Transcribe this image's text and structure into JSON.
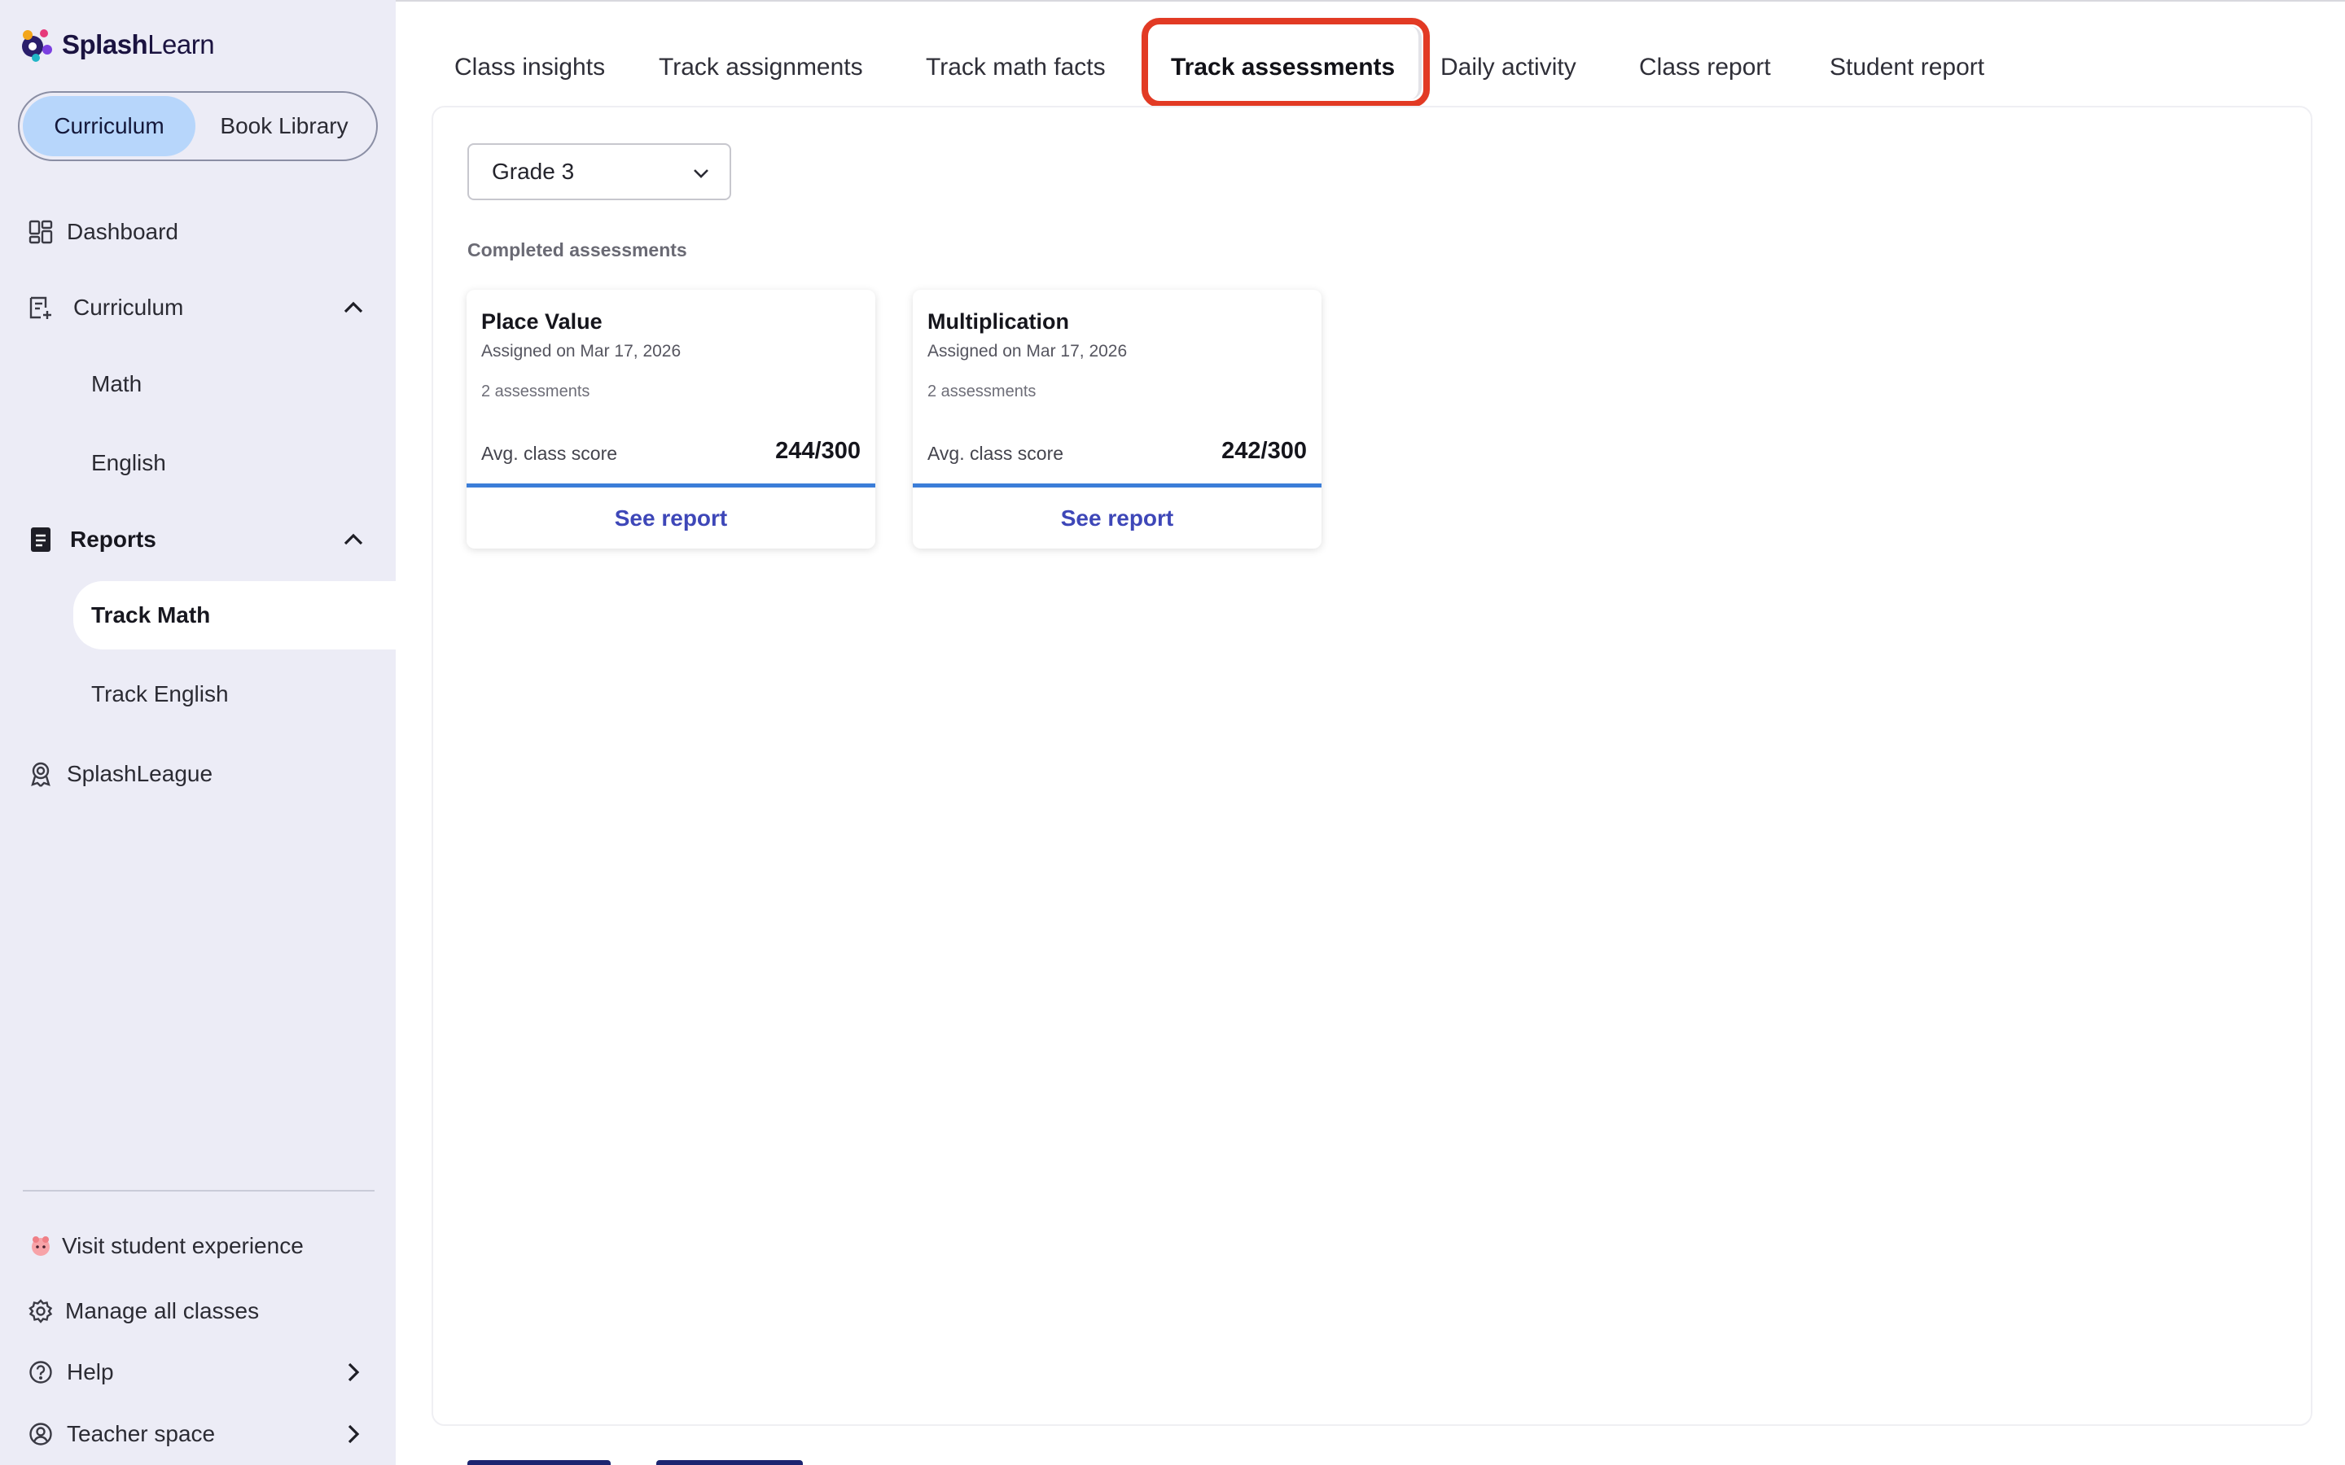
{
  "brand": {
    "name_bold": "Splash",
    "name_rest": "Learn"
  },
  "segment": {
    "active": "Curriculum",
    "other": "Book Library"
  },
  "sidebar": {
    "dashboard": "Dashboard",
    "curriculum": "Curriculum",
    "curriculum_items": [
      "Math",
      "English"
    ],
    "reports": "Reports",
    "reports_items": [
      "Track Math",
      "Track English"
    ],
    "splashleague": "SplashLeague",
    "footer": {
      "visit": "Visit student experience",
      "manage": "Manage all classes",
      "help": "Help",
      "teacher": "Teacher space"
    }
  },
  "tabs": [
    "Class insights",
    "Track assignments",
    "Track math facts",
    "Track assessments",
    "Daily activity",
    "Class report",
    "Student report"
  ],
  "active_tab": "Track assessments",
  "grade_select": {
    "value": "Grade 3"
  },
  "section_label": "Completed assessments",
  "cards": [
    {
      "title": "Place Value",
      "assigned": "Assigned on Mar 17, 2026",
      "count": "2 assessments",
      "avg_label": "Avg. class score",
      "score": "244/300",
      "cta": "See report"
    },
    {
      "title": "Multiplication",
      "assigned": "Assigned on Mar 17, 2026",
      "count": "2 assessments",
      "avg_label": "Avg. class score",
      "score": "242/300",
      "cta": "See report"
    }
  ],
  "colors": {
    "sidebar_bg": "#ececf6",
    "segment_active": "#b7d6fb",
    "highlight": "#e23a24",
    "link": "#3e47b8",
    "card_bar": "#3b7dd8"
  }
}
